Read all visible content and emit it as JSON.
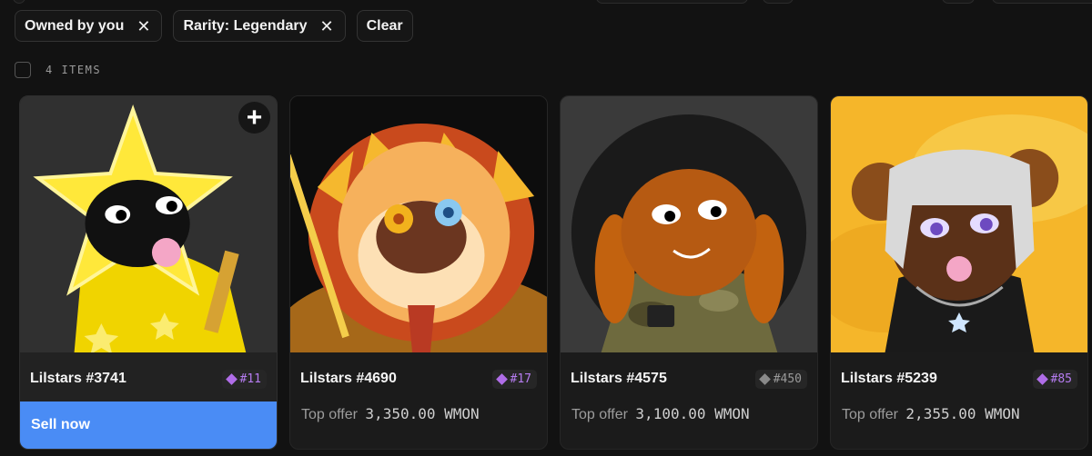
{
  "filters": [
    {
      "label": "Owned by you",
      "remove_icon": "close-icon"
    },
    {
      "label": "Rarity: Legendary",
      "remove_icon": "close-icon"
    }
  ],
  "clear_label": "Clear",
  "items_count": "4 ITEMS",
  "cards": [
    {
      "name": "Lilstars #3741",
      "rank": "#11",
      "rank_color": "#b06de8",
      "action": "Sell now",
      "owned": true
    },
    {
      "name": "Lilstars #4690",
      "rank": "#17",
      "rank_color": "#b06de8",
      "offer_label": "Top offer",
      "offer_value": "3,350.00  WMON"
    },
    {
      "name": "Lilstars #4575",
      "rank": "#450",
      "rank_color": "#8a8a8a",
      "offer_label": "Top offer",
      "offer_value": "3,100.00  WMON"
    },
    {
      "name": "Lilstars #5239",
      "rank": "#85",
      "rank_color": "#b06de8",
      "offer_label": "Top offer",
      "offer_value": "2,355.00  WMON"
    }
  ],
  "colors": {
    "accent": "#4a8cf5",
    "legendary": "#b06de8",
    "background": "#121212"
  }
}
